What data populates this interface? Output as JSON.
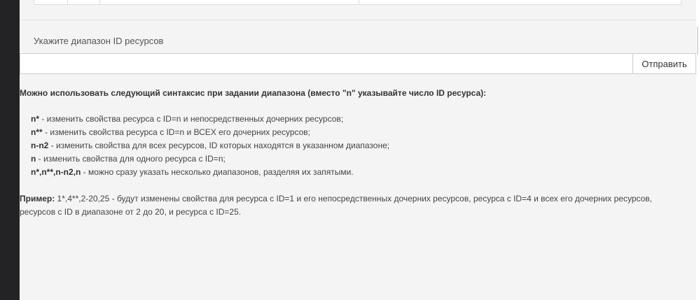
{
  "range_form": {
    "label": "Укажите диапазон ID ресурсов",
    "input_value": "",
    "submit_label": "Отправить"
  },
  "help": {
    "title": "Можно использовать следующий синтаксис при задании диапазона (вместо \"n\" указывайте число ID ресурса):",
    "items": [
      {
        "syntax": "n*",
        "desc": " - изменить свойства ресурса с ID=n и непосредственных дочерних ресурсов;"
      },
      {
        "syntax": "n**",
        "desc": " - изменить свойства ресурса с ID=n и ВСЕХ его дочерних ресурсов;"
      },
      {
        "syntax": "n-n2",
        "desc": " - изменить свойства для всех ресурсов, ID которых находятся в указанном диапазоне;"
      },
      {
        "syntax": "n",
        "desc": " - изменить свойства для одного ресурса с ID=n;"
      },
      {
        "syntax": "n*,n**,n-n2,n",
        "desc": " - можно сразу указать несколько диапазонов, разделяя их запятыми."
      }
    ],
    "example_label": "Пример:",
    "example_text": " 1*,4**,2-20,25 - будут изменены свойства для ресурса с ID=1 и его непосредственных дочерних ресурсов, ресурса с ID=4 и всех его дочерних ресурсов, ресурсов с ID в диапазоне от 2 до 20, и ресурса с ID=25."
  }
}
